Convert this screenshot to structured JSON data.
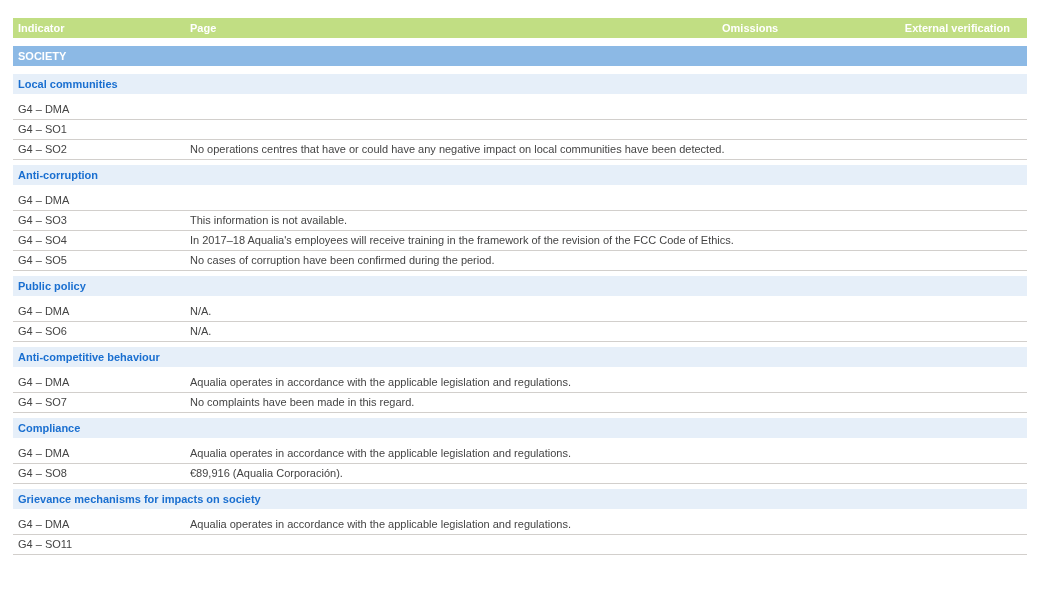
{
  "table": {
    "columns": [
      "Indicator",
      "Page",
      "Omissions",
      "External verification"
    ],
    "section": "SOCIETY",
    "groups": [
      {
        "title": "Local communities",
        "rows": [
          {
            "indicator": "G4 – DMA"
          },
          {
            "indicator": "G4 – SO1"
          },
          {
            "indicator": "G4 – SO2",
            "page": "No operations centres that have or could have any negative impact on local communities have been detected."
          }
        ]
      },
      {
        "title": "Anti-corruption",
        "rows": [
          {
            "indicator": "G4 – DMA"
          },
          {
            "indicator": "G4 – SO3",
            "page": "This information is not available."
          },
          {
            "indicator": "G4 – SO4",
            "page": "In 2017–18 Aqualia's employees will receive training in the framework of the revision of the FCC Code of Ethics."
          },
          {
            "indicator": "G4 – SO5",
            "page": "No cases of corruption have been confirmed during the period."
          }
        ]
      },
      {
        "title": "Public policy",
        "rows": [
          {
            "indicator": "G4 – DMA",
            "page": "N/A."
          },
          {
            "indicator": "G4 – SO6",
            "page": "N/A."
          }
        ]
      },
      {
        "title": "Anti-competitive behaviour",
        "rows": [
          {
            "indicator": "G4 – DMA",
            "page": "Aqualia operates in accordance with the applicable legislation and regulations."
          },
          {
            "indicator": "G4 – SO7",
            "page": "No complaints have been made in this regard."
          }
        ]
      },
      {
        "title": "Compliance",
        "rows": [
          {
            "indicator": "G4 – DMA",
            "page": "Aqualia operates in accordance with the applicable legislation and regulations."
          },
          {
            "indicator": "G4 – SO8",
            "page": "€89,916 (Aqualia Corporación)."
          }
        ]
      },
      {
        "title": "Grievance mechanisms for impacts on society",
        "rows": [
          {
            "indicator": "G4 – DMA",
            "page": "Aqualia operates in accordance with the applicable legislation and regulations."
          },
          {
            "indicator": "G4 – SO11"
          }
        ]
      }
    ]
  }
}
